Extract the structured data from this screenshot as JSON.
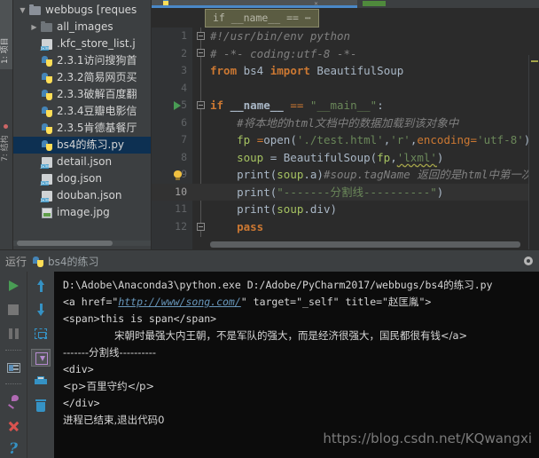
{
  "leftstrip": {
    "tabs": [
      {
        "label": "1: 项目",
        "selected": true
      },
      {
        "label": "7: 结构",
        "selected": false
      }
    ]
  },
  "project": {
    "items": [
      {
        "label": "webbugs [reques",
        "bold_part": "reques",
        "icon": "folder-icon",
        "twist": "▼",
        "indent": 1,
        "selected": false
      },
      {
        "label": "all_images",
        "icon": "folder-dark-icon",
        "twist": "▶",
        "indent": 2,
        "selected": false
      },
      {
        "label": ".kfc_store_list.j",
        "icon": "json-icon",
        "twist": "",
        "indent": 3,
        "selected": false
      },
      {
        "label": "2.3.1访问搜狗首",
        "icon": "python-icon",
        "twist": "",
        "indent": 3,
        "selected": false
      },
      {
        "label": "2.3.2简易网页买",
        "icon": "python-icon",
        "twist": "",
        "indent": 3,
        "selected": false
      },
      {
        "label": "2.3.3破解百度翻",
        "icon": "python-icon",
        "twist": "",
        "indent": 3,
        "selected": false
      },
      {
        "label": "2.3.4豆瓣电影信",
        "icon": "python-icon",
        "twist": "",
        "indent": 3,
        "selected": false
      },
      {
        "label": "2.3.5肯德基餐厅",
        "icon": "python-icon",
        "twist": "",
        "indent": 3,
        "selected": false
      },
      {
        "label": "bs4的练习.py",
        "icon": "python-icon",
        "twist": "",
        "indent": 3,
        "selected": true
      },
      {
        "label": "detail.json",
        "icon": "json-icon",
        "twist": "",
        "indent": 3,
        "selected": false
      },
      {
        "label": "dog.json",
        "icon": "json-icon",
        "twist": "",
        "indent": 3,
        "selected": false
      },
      {
        "label": "douban.json",
        "icon": "json-icon",
        "twist": "",
        "indent": 3,
        "selected": false
      },
      {
        "label": "image.jpg",
        "icon": "image-icon",
        "twist": "",
        "indent": 3,
        "selected": false
      }
    ]
  },
  "editor": {
    "breadcrumb_popup": "if __name__ == ⋯",
    "line_numbers": [
      "1",
      "2",
      "3",
      "4",
      "5",
      "6",
      "7",
      "8",
      "9",
      "10",
      "11",
      "12"
    ],
    "current_line": 10,
    "gutter_markers": {
      "run_arrow_line": 5,
      "bulb_line": 9
    },
    "lines": [
      {
        "n": 1,
        "text": "#!/usr/bin/env python"
      },
      {
        "n": 2,
        "text": "# -*- coding:utf-8 -*-"
      },
      {
        "n": 3,
        "text": "from bs4 import BeautifulSoup"
      },
      {
        "n": 4,
        "text": ""
      },
      {
        "n": 5,
        "text": "if __name__ == \"__main__\":"
      },
      {
        "n": 6,
        "text": "    #将本地的html文档中的数据加载到该对象中"
      },
      {
        "n": 7,
        "text": "    fp =open('./test.html','r',encoding='utf-8')"
      },
      {
        "n": 8,
        "text": "    soup = BeautifulSoup(fp,'lxml')"
      },
      {
        "n": 9,
        "text": "    print(soup.a)#soup.tagName 返回的是html中第一次出现的"
      },
      {
        "n": 10,
        "text": "    print(\"-------分割线----------\")"
      },
      {
        "n": 11,
        "text": "    print(soup.div)"
      },
      {
        "n": 12,
        "text": "    pass"
      }
    ],
    "colors": {
      "background": "#2b2b2b",
      "gutter": "#313335",
      "keyword": "#cc7832",
      "string": "#6a8759",
      "comment": "#808080",
      "default": "#a9b7c6",
      "number": "#6897bb"
    }
  },
  "run_panel": {
    "title": "运行",
    "tab_name": "bs4的练习",
    "gear_icon": "gear-icon",
    "left_toolbar": [
      {
        "name": "rerun-button",
        "icon": "play-icon"
      },
      {
        "name": "stop-button",
        "icon": "stop-icon"
      },
      {
        "name": "pause-button",
        "icon": "pause-icon"
      },
      {
        "name": "layout-button",
        "icon": "layout-icon"
      },
      {
        "name": "pin-button",
        "icon": "pin-icon"
      },
      {
        "name": "close-button",
        "icon": "close-x-icon"
      },
      {
        "name": "help-button",
        "icon": "question-mark-icon"
      }
    ],
    "right_toolbar": [
      {
        "name": "up-button",
        "icon": "arrow-up-icon"
      },
      {
        "name": "down-button",
        "icon": "arrow-down-icon"
      },
      {
        "name": "soft-wrap-button",
        "icon": "soft-wrap-icon"
      },
      {
        "name": "scroll-to-end-button",
        "icon": "scroll-to-end-icon",
        "pressed": true
      },
      {
        "name": "print-button",
        "icon": "print-icon"
      },
      {
        "name": "clear-all-button",
        "icon": "trash-icon"
      }
    ],
    "console_lines": [
      {
        "type": "plain",
        "text": "D:\\Adobe\\Anaconda3\\python.exe D:/Adobe/PyCharm2017/webbugs/bs4的练习.py"
      },
      {
        "type": "link",
        "pre": "<a href=\"",
        "link": "http://www/song.com/",
        "post": "\" target=\"_self\" title=\"赵匡胤\">"
      },
      {
        "type": "plain",
        "text": "<span>this is span</span>"
      },
      {
        "type": "indented",
        "text": "宋朝时最强大内王朝，不是军队的强大，而是经济很强大，国民都很有钱</a>"
      },
      {
        "type": "plain",
        "text": "-------分割线----------"
      },
      {
        "type": "plain",
        "text": "<div>"
      },
      {
        "type": "plain",
        "text": "<p>百里守约</p>"
      },
      {
        "type": "plain",
        "text": "</div>"
      },
      {
        "type": "plain",
        "text": ""
      },
      {
        "type": "plain",
        "text": "进程已结束,退出代码0"
      }
    ]
  },
  "watermark": "https://blog.csdn.net/KQwangxi"
}
